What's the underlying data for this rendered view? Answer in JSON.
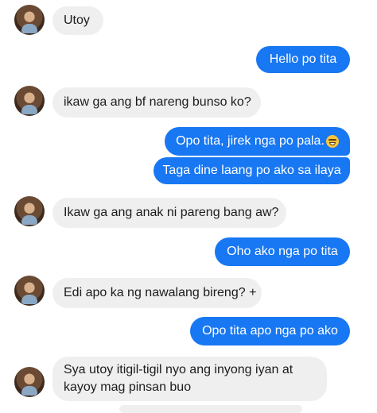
{
  "messages": [
    {
      "from": "them",
      "text": "Utoy"
    },
    {
      "from": "me",
      "text": "Hello po tita"
    },
    {
      "from": "them",
      "text": "ikaw ga ang bf nareng bunso ko?"
    },
    {
      "from": "me",
      "text": "Opo tita, jirek nga po pala.",
      "emoji": "grinning-sweat-emoji"
    },
    {
      "from": "me",
      "text": "Taga dine laang po ako sa ilaya"
    },
    {
      "from": "them",
      "text": "Ikaw ga ang anak ni pareng bang aw?"
    },
    {
      "from": "me",
      "text": "Oho ako nga po tita"
    },
    {
      "from": "them",
      "text": "Edi apo ka ng nawalang bireng? +"
    },
    {
      "from": "me",
      "text": "Opo tita apo nga po ako"
    },
    {
      "from": "them",
      "text": "Sya utoy itigil-tigil nyo ang inyong iyan at kayoy mag pinsan buo"
    }
  ],
  "colors": {
    "outgoing": "#1877f2",
    "incoming": "#efefef"
  }
}
